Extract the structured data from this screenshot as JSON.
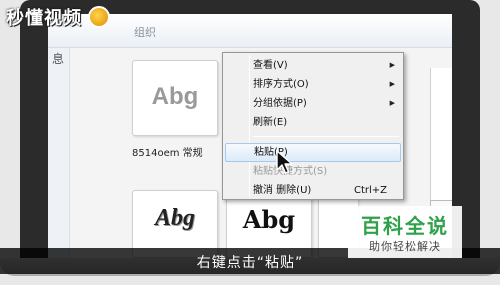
{
  "watermark": {
    "logo_text": "秒懂视频"
  },
  "window": {
    "header_text": "组织",
    "left_edge_text": "息"
  },
  "fonts": {
    "sample_text": "Abg",
    "label": "8514oem 常规"
  },
  "context_menu": {
    "items": [
      {
        "label": "查看(V)",
        "has_submenu": true
      },
      {
        "label": "排序方式(O)",
        "has_submenu": true
      },
      {
        "label": "分组依据(P)",
        "has_submenu": true
      },
      {
        "label": "刷新(E)",
        "has_submenu": false
      },
      {
        "label": "粘贴(P)",
        "highlighted": true
      },
      {
        "label": "粘贴快捷方式(S)",
        "disabled": true
      },
      {
        "label": "撤消 删除(U)",
        "shortcut": "Ctrl+Z"
      }
    ]
  },
  "subtitle": "右键点击“粘贴”",
  "baike": {
    "title": "百科全说",
    "subtitle": "助你轻松解决"
  },
  "colors": {
    "baike_green": "#2ea14a",
    "highlight_border": "#a8c8ec"
  }
}
